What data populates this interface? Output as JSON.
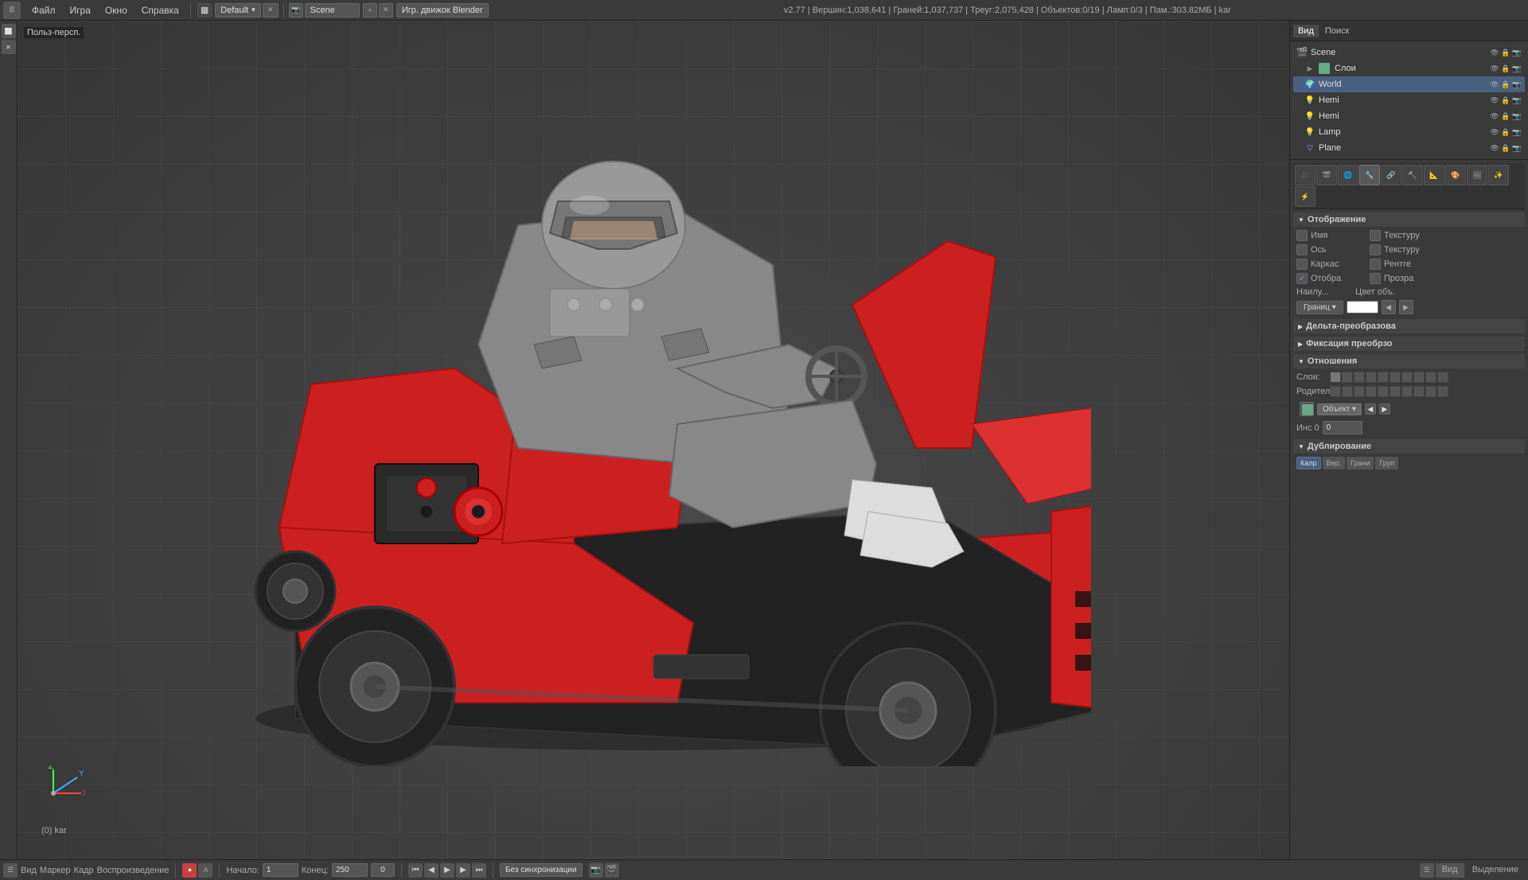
{
  "topbar": {
    "logo": "B",
    "menus": [
      "Файл",
      "Игра",
      "Окно",
      "Справка"
    ],
    "mode_icon": "▦",
    "mode": "Default",
    "scene_label": "Scene",
    "engine": "Игр. движок Blender",
    "status": "v2.77 | Вершин:1,038,641 | Граней:1,037,737 | Треуг:2,075,428 | Объектов:0/19 | Ламп:0/3 | Пам.:303.82МБ | kar"
  },
  "viewport": {
    "label": "Польз-персп.",
    "object_info": "(0) kar"
  },
  "scene_tree": {
    "title": "Scene",
    "items": [
      {
        "label": "Scene",
        "indent": 0,
        "icon": "🎬",
        "type": "scene"
      },
      {
        "label": "Слои",
        "indent": 1,
        "icon": "📋",
        "type": "layers"
      },
      {
        "label": "World",
        "indent": 1,
        "icon": "🌍",
        "type": "world",
        "selected": true
      },
      {
        "label": "Hemi",
        "indent": 1,
        "icon": "💡",
        "type": "lamp"
      },
      {
        "label": "Hemi",
        "indent": 1,
        "icon": "💡",
        "type": "lamp2"
      },
      {
        "label": "Lamp",
        "indent": 1,
        "icon": "💡",
        "type": "lamp3"
      },
      {
        "label": "Plane",
        "indent": 1,
        "icon": "▭",
        "type": "mesh"
      }
    ]
  },
  "properties": {
    "tabs": [
      "🔑",
      "👁",
      "📷",
      "🌐",
      "🎨",
      "⚡",
      "🔧",
      "⬜",
      "🔗",
      "📐",
      "🎭",
      "💫"
    ],
    "display_section": {
      "title": "Отображение",
      "rows": [
        {
          "label": "Имя",
          "type": "checkbox_pair",
          "right": "Текстуру"
        },
        {
          "label": "Ось",
          "type": "checkbox_pair",
          "right": "Текстуру"
        },
        {
          "label": "Каркас",
          "type": "checkbox_pair",
          "right": "Рентге"
        },
        {
          "label": "Отобра",
          "type": "checkbox_checked",
          "right": "Прозра"
        }
      ],
      "nailu_label": "Наилу...",
      "cvet_label": "Цвет объ.",
      "granits_btn": "Границ ▾",
      "color_value": "#ffffff"
    },
    "delta_section": {
      "title": "Дельта-преобразова"
    },
    "fiksacia_section": {
      "title": "Фиксация преобрзо"
    },
    "relations_section": {
      "title": "Отношения",
      "sloi_label": "Слои:",
      "roditel_label": "Родитель:",
      "sloi_cells": 20,
      "obj_btn": "Объект ▾",
      "inc_label": "Инс 0",
      "inc_value": "0"
    },
    "duplication_section": {
      "title": "Дублирование",
      "buttons": [
        "Калр",
        "Вер.",
        "Грани",
        "Груп"
      ]
    }
  },
  "bottom_bar": {
    "view_label": "Вид",
    "marker_label": "Маркер",
    "kadr_label": "Кадр",
    "playback_label": "Воспроизведение",
    "start_label": "Начало:",
    "start_value": "1",
    "end_label": "Конец:",
    "end_value": "250",
    "frame_value": "0",
    "sync_label": "Без синхронизации",
    "right_tabs": [
      "Вид",
      "Выделение"
    ]
  }
}
